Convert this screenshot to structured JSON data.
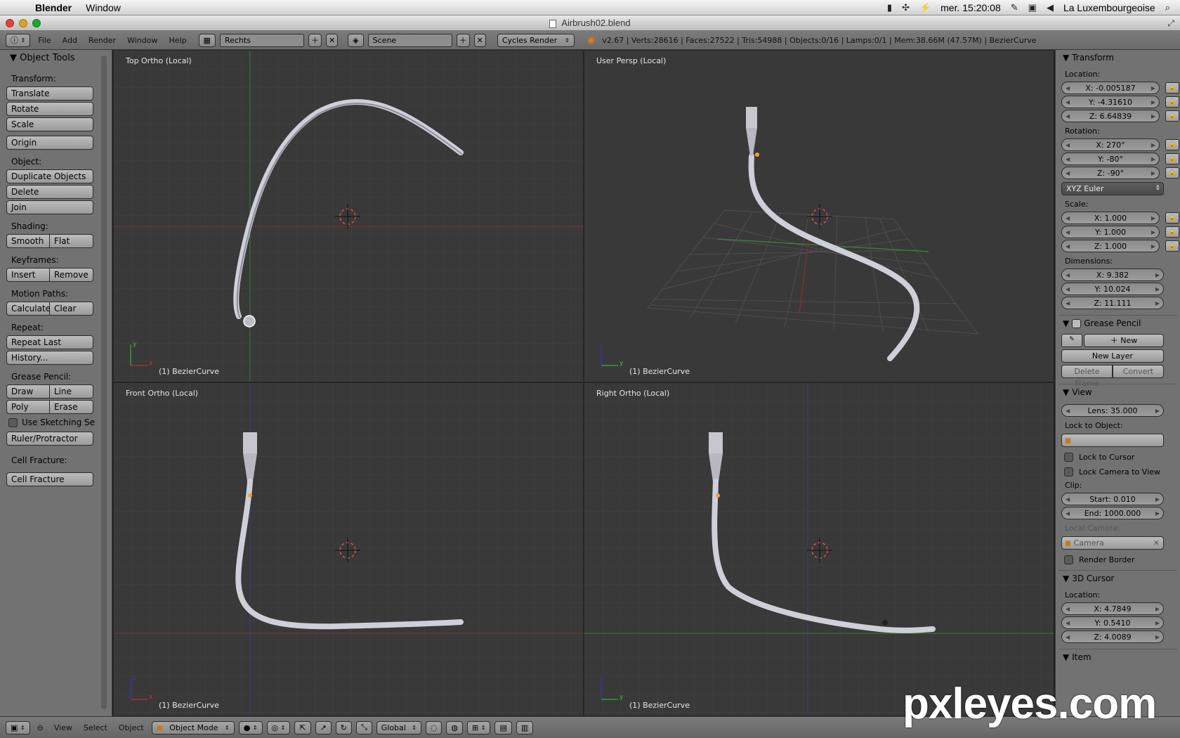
{
  "menubar": {
    "app": "Blender",
    "window": "Window",
    "clock": "mer. 15:20:08",
    "location": "La Luxembourgeoise"
  },
  "titlebar": {
    "title": "Airbrush02.blend"
  },
  "header": {
    "menus": [
      "File",
      "Add",
      "Render",
      "Window",
      "Help"
    ],
    "layout": "Rechts",
    "scene": "Scene",
    "engine": "Cycles Render",
    "stats": "v2.67 | Verts:28616 | Faces:27522 | Tris:54988 | Objects:0/16 | Lamps:0/1 | Mem:38.66M (47.57M) | BezierCurve"
  },
  "toolshelf": {
    "title": "Object Tools",
    "transform_label": "Transform:",
    "translate": "Translate",
    "rotate": "Rotate",
    "scale": "Scale",
    "origin": "Origin",
    "object_label": "Object:",
    "duplicate": "Duplicate Objects",
    "delete": "Delete",
    "join": "Join",
    "shading_label": "Shading:",
    "smooth": "Smooth",
    "flat": "Flat",
    "keyframes_label": "Keyframes:",
    "insert": "Insert",
    "remove": "Remove",
    "motion_label": "Motion Paths:",
    "calculate": "Calculate",
    "clear": "Clear",
    "repeat_label": "Repeat:",
    "repeat_last": "Repeat Last",
    "history": "History...",
    "gp_label": "Grease Pencil:",
    "draw": "Draw",
    "line": "Line",
    "poly": "Poly",
    "erase": "Erase",
    "sketching": "Use Sketching Se",
    "ruler": "Ruler/Protractor",
    "cell_label": "Cell Fracture:",
    "cell_btn": "Cell Fracture"
  },
  "viewports": {
    "top": "Top Ortho (Local)",
    "persp": "User Persp (Local)",
    "front": "Front Ortho (Local)",
    "right": "Right Ortho (Local)",
    "object": "(1) BezierCurve"
  },
  "npanel": {
    "transform": "Transform",
    "location": "Location:",
    "loc_x": "X: -0.005187",
    "loc_y": "Y: -4.31610",
    "loc_z": "Z: 6.64839",
    "rotation": "Rotation:",
    "rot_x": "X: 270°",
    "rot_y": "Y: -80°",
    "rot_z": "Z: -90°",
    "euler": "XYZ Euler",
    "scale": "Scale:",
    "sc_x": "X: 1.000",
    "sc_y": "Y: 1.000",
    "sc_z": "Z: 1.000",
    "dimensions": "Dimensions:",
    "dim_x": "X: 9.382",
    "dim_y": "Y: 10.024",
    "dim_z": "Z: 11.111",
    "grease": "Grease Pencil",
    "new": "New",
    "new_layer": "New Layer",
    "delete_frame": "Delete Frame",
    "convert": "Convert",
    "view": "View",
    "lens": "Lens: 35.000",
    "lock_obj": "Lock to Object:",
    "lock_cursor": "Lock to Cursor",
    "lock_camera": "Lock Camera to View",
    "clip": "Clip:",
    "clip_start": "Start: 0.010",
    "clip_end": "End: 1000.000",
    "local_camera": "Local Camera:",
    "camera": "Camera",
    "render_border": "Render Border",
    "cursor3d": "3D Cursor",
    "cur_location": "Location:",
    "cur_x": "X: 4.7849",
    "cur_y": "Y: 0.5410",
    "cur_z": "Z: 4.0089",
    "item": "Item"
  },
  "footer": {
    "view": "View",
    "select": "Select",
    "object": "Object",
    "mode": "Object Mode",
    "orientation": "Global"
  },
  "watermark": "pxleyes.com"
}
